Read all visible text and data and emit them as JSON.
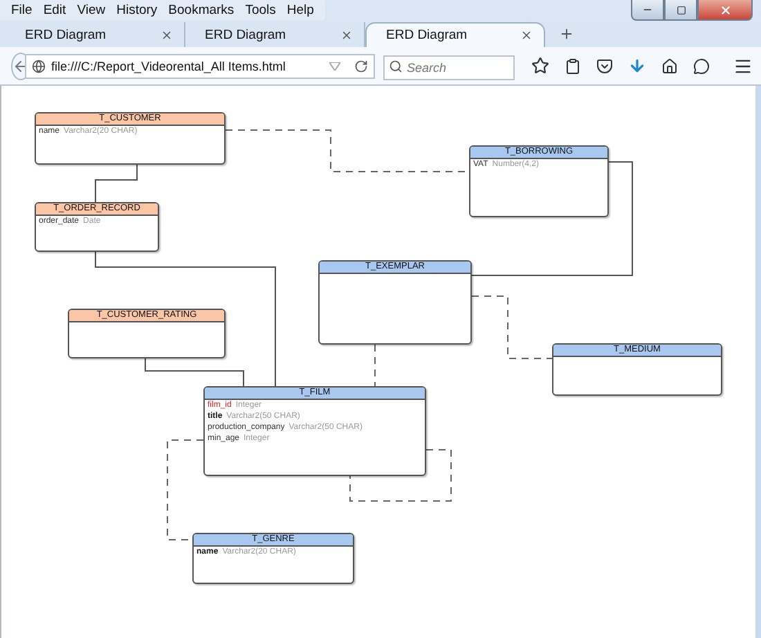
{
  "menu": [
    "File",
    "Edit",
    "View",
    "History",
    "Bookmarks",
    "Tools",
    "Help"
  ],
  "tabs": [
    {
      "label": "ERD Diagram",
      "selected": false
    },
    {
      "label": "ERD Diagram",
      "selected": false
    },
    {
      "label": "ERD Diagram",
      "selected": true
    }
  ],
  "address_bar": {
    "url": "file:///C:/Report_Videorental_All Items.html"
  },
  "search": {
    "placeholder": "Search"
  },
  "diagram": {
    "entities": [
      {
        "name": "T_CUSTOMER",
        "color": "#fbc6a6",
        "columns": [
          {
            "name": "name",
            "type": "Varchar2(20 CHAR)",
            "kind": "plain"
          }
        ]
      },
      {
        "name": "T_ORDER_RECORD",
        "color": "#fbc6a6",
        "columns": [
          {
            "name": "order_date",
            "type": "Date",
            "kind": "plain"
          }
        ]
      },
      {
        "name": "T_BORROWING",
        "color": "#a8c8f0",
        "columns": [
          {
            "name": "VAT",
            "type": "Number(4,2)",
            "kind": "plain"
          }
        ]
      },
      {
        "name": "T_EXEMPLAR",
        "color": "#a8c8f0"
      },
      {
        "name": "T_CUSTOMER_RATING",
        "color": "#fbc6a6"
      },
      {
        "name": "T_MEDIUM",
        "color": "#a8c8f0"
      },
      {
        "name": "T_FILM",
        "color": "#a8c8f0",
        "columns": [
          {
            "name": "film_id",
            "type": "Integer",
            "kind": "primary"
          },
          {
            "name": "title",
            "type": "Varchar2(50 CHAR)",
            "kind": "mandatory"
          },
          {
            "name": "production_company",
            "type": "Varchar2(50 CHAR)",
            "kind": "plain"
          },
          {
            "name": "min_age",
            "type": "Integer",
            "kind": "plain"
          }
        ]
      },
      {
        "name": "T_GENRE",
        "color": "#a8c8f0",
        "columns": [
          {
            "name": "name",
            "type": "Varchar2(20 CHAR)",
            "kind": "mandatory"
          }
        ]
      }
    ]
  }
}
